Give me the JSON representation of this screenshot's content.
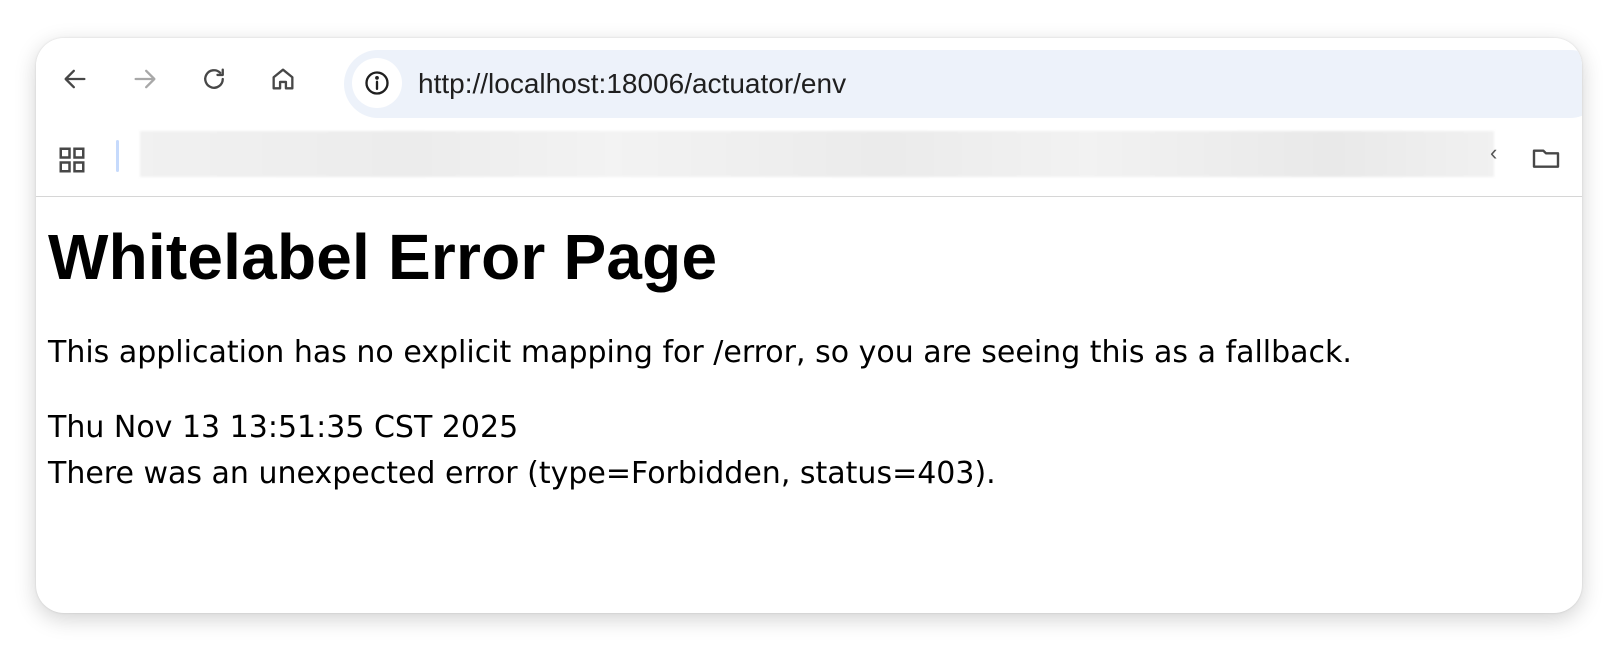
{
  "browser": {
    "url": "http://localhost:18006/actuator/env",
    "bookmarks_overflow_glyph": "‹"
  },
  "page": {
    "title": "Whitelabel Error Page",
    "message": "This application has no explicit mapping for /error, so you are seeing this as a fallback.",
    "timestamp": "Thu Nov 13 13:51:35 CST 2025",
    "error": "There was an unexpected error (type=Forbidden, status=403)."
  },
  "icons": {
    "back": "arrow-left-icon",
    "forward": "arrow-right-icon",
    "reload": "reload-icon",
    "home": "home-icon",
    "site_info": "info-icon",
    "apps": "apps-grid-icon",
    "folder": "folder-icon"
  },
  "colors": {
    "omnibox_bg": "#edf2fa",
    "icon_active": "#474747",
    "icon_disabled": "#a8a8a8",
    "bookmark_separator": "#c6dafc"
  }
}
